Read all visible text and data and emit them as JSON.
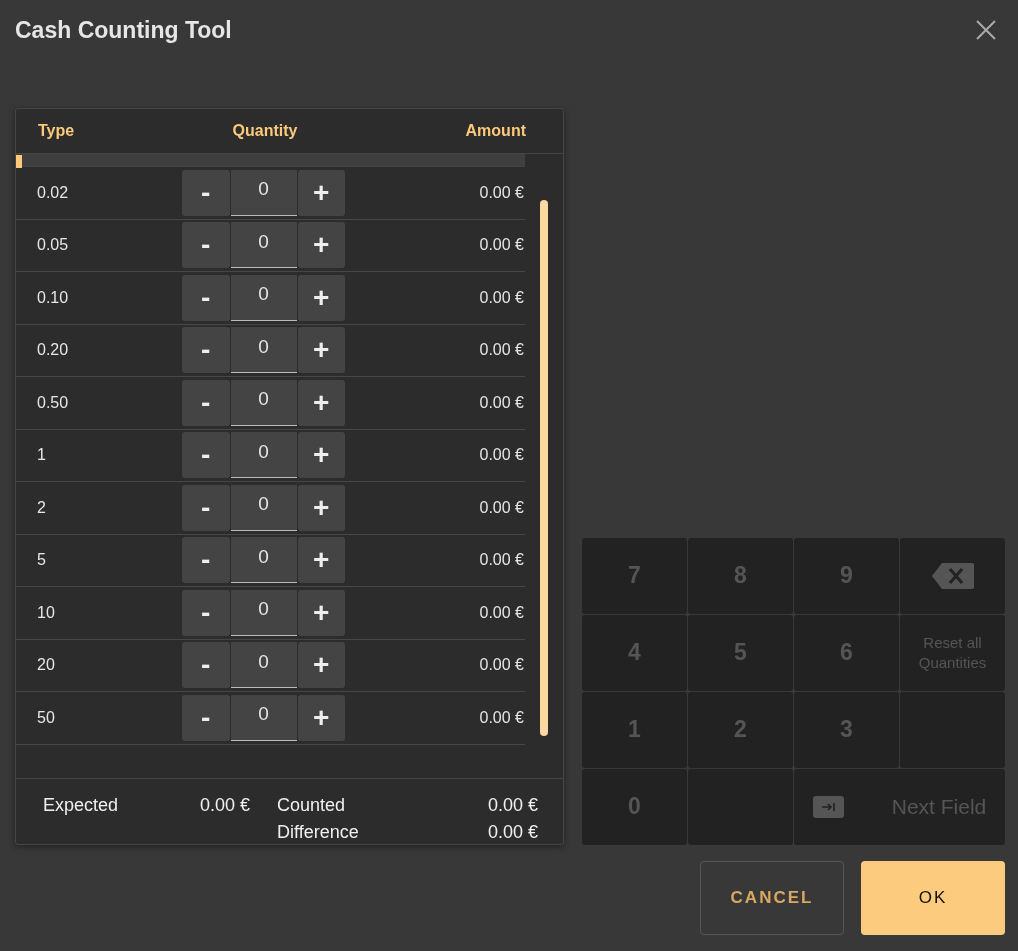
{
  "window": {
    "title": "Cash Counting Tool"
  },
  "table": {
    "columns": [
      "Type",
      "Quantity",
      "Amount"
    ],
    "rows": [
      {
        "type": "0.02",
        "quantity": "0",
        "amount": "0.00 €"
      },
      {
        "type": "0.05",
        "quantity": "0",
        "amount": "0.00 €"
      },
      {
        "type": "0.10",
        "quantity": "0",
        "amount": "0.00 €"
      },
      {
        "type": "0.20",
        "quantity": "0",
        "amount": "0.00 €"
      },
      {
        "type": "0.50",
        "quantity": "0",
        "amount": "0.00 €"
      },
      {
        "type": "1",
        "quantity": "0",
        "amount": "0.00 €"
      },
      {
        "type": "2",
        "quantity": "0",
        "amount": "0.00 €"
      },
      {
        "type": "5",
        "quantity": "0",
        "amount": "0.00 €"
      },
      {
        "type": "10",
        "quantity": "0",
        "amount": "0.00 €"
      },
      {
        "type": "20",
        "quantity": "0",
        "amount": "0.00 €"
      },
      {
        "type": "50",
        "quantity": "0",
        "amount": "0.00 €"
      }
    ],
    "minus_label": "-",
    "plus_label": "+"
  },
  "summary": {
    "expected_label": "Expected",
    "expected": "0.00 €",
    "counted_label": "Counted",
    "counted": "0.00 €",
    "difference_label": "Difference",
    "difference": "0.00 €"
  },
  "keypad": {
    "disabled": true,
    "keys": [
      {
        "kind": "digit",
        "label": "7"
      },
      {
        "kind": "digit",
        "label": "8"
      },
      {
        "kind": "digit",
        "label": "9"
      },
      {
        "kind": "backspace"
      },
      {
        "kind": "digit",
        "label": "4"
      },
      {
        "kind": "digit",
        "label": "5"
      },
      {
        "kind": "digit",
        "label": "6"
      },
      {
        "kind": "text",
        "label": "Reset all Quantities"
      },
      {
        "kind": "digit",
        "label": "1"
      },
      {
        "kind": "digit",
        "label": "2"
      },
      {
        "kind": "digit",
        "label": "3"
      },
      {
        "kind": "empty"
      },
      {
        "kind": "digit",
        "label": "0"
      },
      {
        "kind": "empty"
      },
      {
        "kind": "next",
        "label": "Next Field"
      }
    ]
  },
  "buttons": [
    {
      "kind": "secondary",
      "label": "CANCEL"
    },
    {
      "kind": "primary",
      "label": "OK"
    }
  ]
}
